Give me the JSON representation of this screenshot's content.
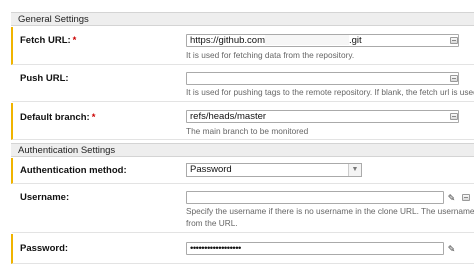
{
  "general_section": {
    "title": "General Settings"
  },
  "fetch_url": {
    "label": "Fetch URL:",
    "required_marker": "*",
    "value_start": "https://github.com",
    "value_end": ".git",
    "help": "It is used for fetching data from the repository."
  },
  "push_url": {
    "label": "Push URL:",
    "value": "",
    "help": "It is used for pushing tags to the remote repository. If blank, the fetch url is used."
  },
  "default_branch": {
    "label": "Default branch:",
    "required_marker": "*",
    "value": "refs/heads/master",
    "help": "The main branch to be monitored"
  },
  "auth_section": {
    "title": "Authentication Settings"
  },
  "auth_method": {
    "label": "Authentication method:",
    "value": "Password"
  },
  "username": {
    "label": "Username:",
    "value": "",
    "help_line1": "Specify the username if there is no username in the clone URL. The username speci",
    "help_line2": "from the URL."
  },
  "password": {
    "label": "Password:",
    "value": "••••••••••••••••••"
  },
  "icons": {
    "help_button": "help-icon",
    "key_button": "key-icon",
    "dropdown_arrow": "triangle-down-icon"
  },
  "colors": {
    "required_bar": "#f0b400",
    "required_star": "#cc0000",
    "section_bg": "#eeeeee"
  }
}
